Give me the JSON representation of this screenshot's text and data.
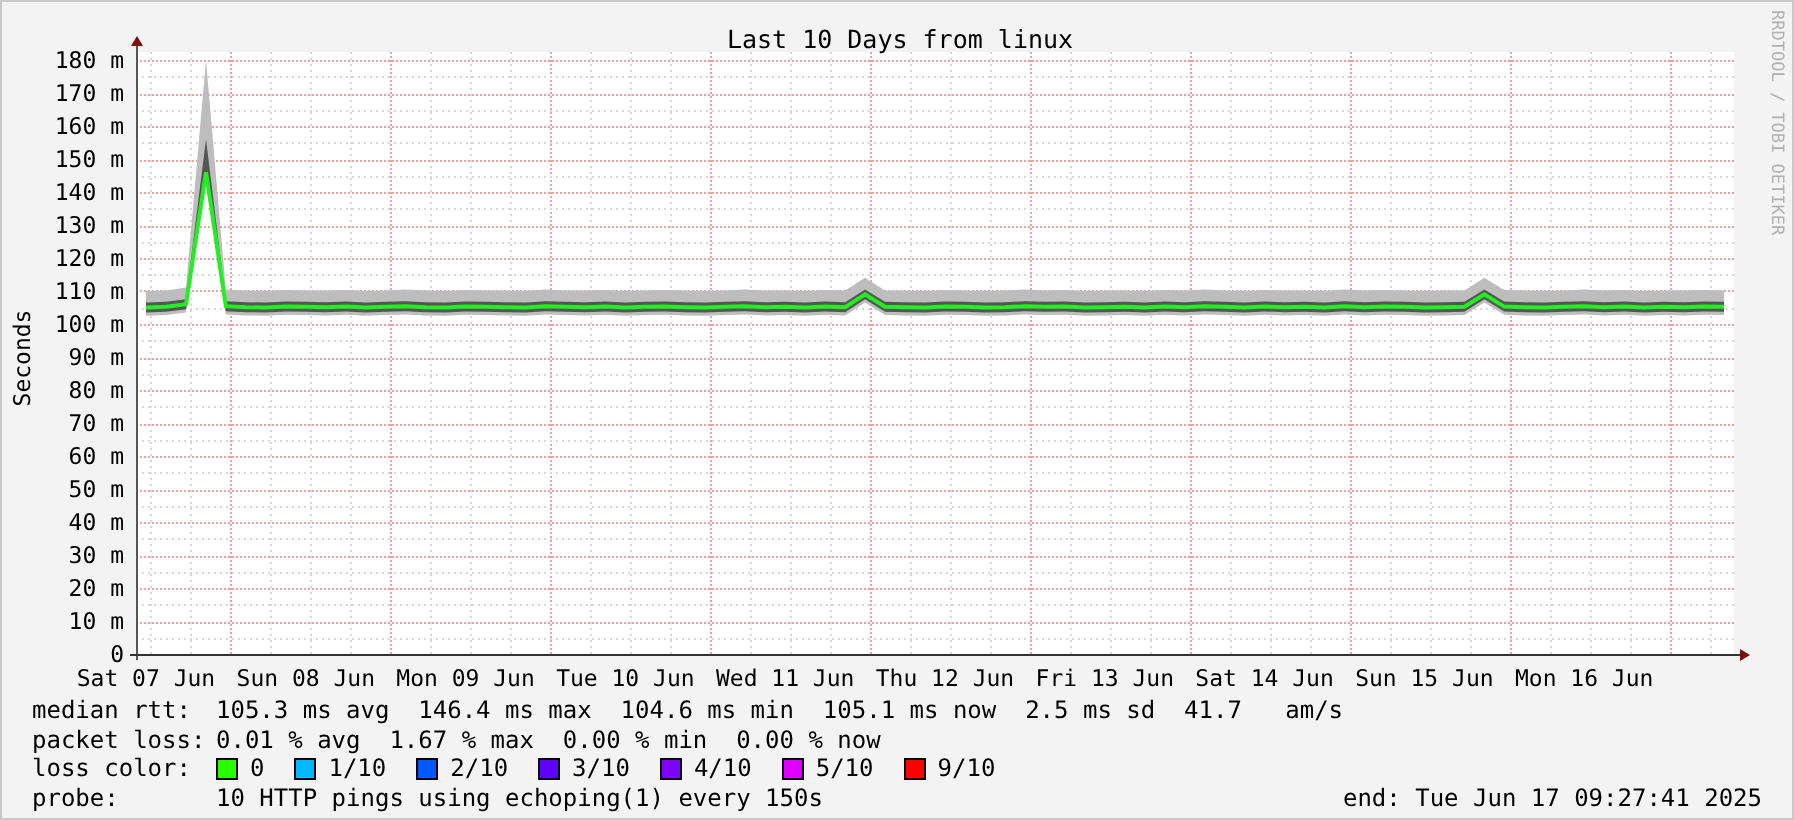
{
  "graph": {
    "title": "Last 10 Days from linux",
    "ylabel": "Seconds",
    "credit": "RRDTOOL / TOBI OETIKER",
    "chart_data": {
      "type": "line",
      "grid": true,
      "ylim": [
        0,
        180
      ],
      "categories": [
        "Sat 07 Jun",
        null,
        null,
        null,
        null,
        null,
        null,
        null,
        "Sun 08 Jun",
        null,
        null,
        null,
        null,
        null,
        null,
        null,
        "Mon 09 Jun",
        null,
        null,
        null,
        null,
        null,
        null,
        null,
        "Tue 10 Jun",
        null,
        null,
        null,
        null,
        null,
        null,
        null,
        "Wed 11 Jun",
        null,
        null,
        null,
        null,
        null,
        null,
        null,
        "Thu 12 Jun",
        null,
        null,
        null,
        null,
        null,
        null,
        null,
        "Fri 13 Jun",
        null,
        null,
        null,
        null,
        null,
        null,
        null,
        "Sat 14 Jun",
        null,
        null,
        null,
        null,
        null,
        null,
        null,
        "Sun 15 Jun",
        null,
        null,
        null,
        null,
        null,
        null,
        null,
        "Mon 16 Jun",
        null,
        null,
        null,
        null,
        null,
        null,
        null
      ],
      "yticks": [
        {
          "value": 0,
          "label": "0"
        },
        {
          "value": 10,
          "label": "10 m"
        },
        {
          "value": 20,
          "label": "20 m"
        },
        {
          "value": 30,
          "label": "30 m"
        },
        {
          "value": 40,
          "label": "40 m"
        },
        {
          "value": 50,
          "label": "50 m"
        },
        {
          "value": 60,
          "label": "60 m"
        },
        {
          "value": 70,
          "label": "70 m"
        },
        {
          "value": 80,
          "label": "80 m"
        },
        {
          "value": 90,
          "label": "90 m"
        },
        {
          "value": 100,
          "label": "100 m"
        },
        {
          "value": 110,
          "label": "110 m"
        },
        {
          "value": 120,
          "label": "120 m"
        },
        {
          "value": 130,
          "label": "130 m"
        },
        {
          "value": 140,
          "label": "140 m"
        },
        {
          "value": 150,
          "label": "150 m"
        },
        {
          "value": 160,
          "label": "160 m"
        },
        {
          "value": 170,
          "label": "170 m"
        },
        {
          "value": 180,
          "label": "180 m"
        }
      ],
      "series": [
        {
          "color": "#22ee22",
          "values": [
            105.0,
            105.2,
            106.0,
            146.0,
            105.4,
            105.1,
            105.0,
            105.3,
            105.2,
            105.1,
            105.3,
            105.0,
            105.2,
            105.4,
            105.1,
            105.0,
            105.3,
            105.2,
            105.1,
            105.0,
            105.4,
            105.2,
            105.1,
            105.3,
            105.0,
            105.2,
            105.3,
            105.1,
            105.0,
            105.2,
            105.4,
            105.1,
            105.2,
            105.0,
            105.3,
            105.1,
            109.0,
            105.2,
            105.1,
            105.0,
            105.3,
            105.2,
            105.0,
            105.1,
            105.4,
            105.2,
            105.3,
            105.0,
            105.1,
            105.2,
            105.0,
            105.3,
            105.1,
            105.4,
            105.2,
            105.0,
            105.3,
            105.1,
            105.2,
            105.0,
            105.4,
            105.1,
            105.3,
            105.2,
            105.0,
            105.1,
            105.2,
            109.0,
            105.3,
            105.1,
            105.0,
            105.2,
            105.4,
            105.1,
            105.3,
            105.0,
            105.2,
            105.1,
            105.3,
            105.2
          ]
        }
      ]
    }
  },
  "legend": {
    "median_rtt": {
      "label": "median rtt:",
      "text": "105.3 ms avg  146.4 ms max  104.6 ms min  105.1 ms now  2.5 ms sd  41.7   am/s"
    },
    "packet_loss": {
      "label": "packet loss:",
      "text": "0.01 % avg  1.67 % max  0.00 % min  0.00 % now"
    },
    "loss_color": {
      "label": "loss color:",
      "items": [
        {
          "label": "0",
          "color": "#26ff00"
        },
        {
          "label": "1/10",
          "color": "#00b8ff"
        },
        {
          "label": "2/10",
          "color": "#0059ff"
        },
        {
          "label": "3/10",
          "color": "#5e00ff"
        },
        {
          "label": "4/10",
          "color": "#7e00ff"
        },
        {
          "label": "5/10",
          "color": "#dd00ff"
        },
        {
          "label": "9/10",
          "color": "#ff0000"
        }
      ]
    },
    "probe": {
      "label": "probe:",
      "text": "10 HTTP pings using echoping(1) every 150s"
    },
    "end": "end: Tue Jun 17 09:27:41 2025"
  }
}
